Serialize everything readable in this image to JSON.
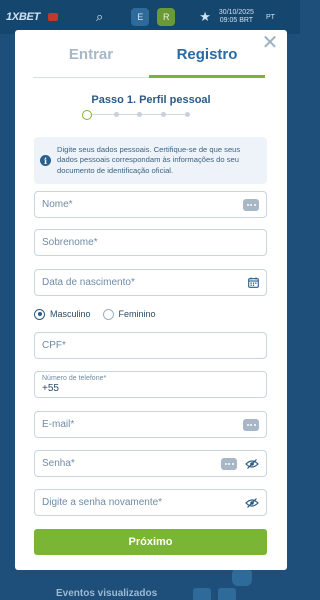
{
  "background": {
    "logo": "1XBET",
    "btn_e": "E",
    "btn_r": "R",
    "datetime_line1": "30/10/2025",
    "datetime_line2": "09:05 BRT",
    "lang": "PT",
    "footer_text": "Eventos visualizados"
  },
  "modal": {
    "close_glyph": "✕",
    "tabs": [
      {
        "label": "Entrar",
        "active": false
      },
      {
        "label": "Registro",
        "active": true
      }
    ],
    "step_title": "Passo 1. Perfil pessoal",
    "steps_total": 5,
    "step_current": 1,
    "info_icon": "i",
    "info_text": "Digite seus dados pessoais. Certifique-se de que seus dados pessoais correspondam às informações do seu documento de identificação oficial.",
    "fields": {
      "name": {
        "placeholder": "Nome*"
      },
      "surname": {
        "placeholder": "Sobrenome*"
      },
      "birthdate": {
        "placeholder": "Data de nascimento*"
      },
      "cpf": {
        "placeholder": "CPF*"
      },
      "phone": {
        "label": "Número de telefone*",
        "value": "+55"
      },
      "email": {
        "placeholder": "E-mail*"
      },
      "password": {
        "placeholder": "Senha*"
      },
      "password_repeat": {
        "placeholder": "Digite a senha novamente*"
      }
    },
    "gender": {
      "options": [
        {
          "label": "Masculino",
          "selected": true
        },
        {
          "label": "Feminino",
          "selected": false
        }
      ]
    },
    "submit_label": "Próximo"
  },
  "colors": {
    "accent": "#7bb536",
    "primary": "#2a6aa4",
    "overlay": "#1d4f7a"
  }
}
